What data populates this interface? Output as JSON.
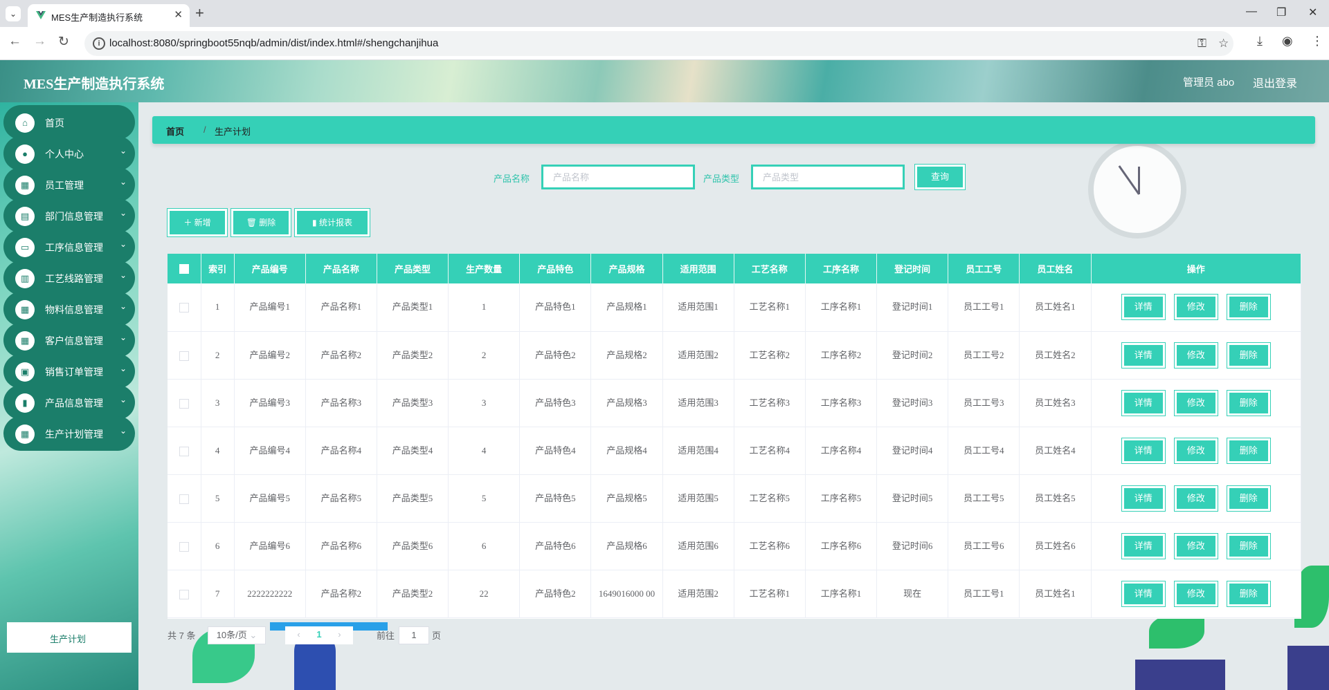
{
  "browser": {
    "tab_title": "MES生产制造执行系统",
    "url": "localhost:8080/springboot55nqb/admin/dist/index.html#/shengchanjihua"
  },
  "header": {
    "title": "MES生产制造执行系统",
    "user": "管理员 abo",
    "logout": "退出登录"
  },
  "sidebar": {
    "items": [
      {
        "label": "首页",
        "icon": "home-icon",
        "glyph": "⌂",
        "expandable": false
      },
      {
        "label": "个人中心",
        "icon": "user-icon",
        "glyph": "●",
        "expandable": true
      },
      {
        "label": "员工管理",
        "icon": "grid-icon",
        "glyph": "▦",
        "expandable": true
      },
      {
        "label": "部门信息管理",
        "icon": "chart-icon",
        "glyph": "▤",
        "expandable": true
      },
      {
        "label": "工序信息管理",
        "icon": "chat-icon",
        "glyph": "▭",
        "expandable": true
      },
      {
        "label": "工艺线路管理",
        "icon": "clipboard-icon",
        "glyph": "▥",
        "expandable": true
      },
      {
        "label": "物料信息管理",
        "icon": "grid-icon",
        "glyph": "▦",
        "expandable": true
      },
      {
        "label": "客户信息管理",
        "icon": "apps-icon",
        "glyph": "▦",
        "expandable": true
      },
      {
        "label": "销售订单管理",
        "icon": "monitor-icon",
        "glyph": "▣",
        "expandable": true
      },
      {
        "label": "产品信息管理",
        "icon": "book-icon",
        "glyph": "▮",
        "expandable": true
      },
      {
        "label": "生产计划管理",
        "icon": "grid-icon",
        "glyph": "▦",
        "expandable": true
      }
    ],
    "submenu_active": "生产计划"
  },
  "breadcrumb": {
    "home": "首页",
    "separator": "/",
    "current": "生产计划"
  },
  "search": {
    "name_label": "产品名称",
    "name_placeholder": "产品名称",
    "type_label": "产品类型",
    "type_placeholder": "产品类型",
    "button": "查询"
  },
  "actions": {
    "add": "新增",
    "delete": "删除",
    "report": "统计报表"
  },
  "table": {
    "columns": [
      "索引",
      "产品编号",
      "产品名称",
      "产品类型",
      "生产数量",
      "产品特色",
      "产品规格",
      "适用范围",
      "工艺名称",
      "工序名称",
      "登记时间",
      "员工工号",
      "员工姓名",
      "操作"
    ],
    "row_actions": {
      "detail": "详情",
      "edit": "修改",
      "delete": "删除"
    },
    "rows": [
      [
        "1",
        "产品编号1",
        "产品名称1",
        "产品类型1",
        "1",
        "产品特色1",
        "产品规格1",
        "适用范围1",
        "工艺名称1",
        "工序名称1",
        "登记时间1",
        "员工工号1",
        "员工姓名1"
      ],
      [
        "2",
        "产品编号2",
        "产品名称2",
        "产品类型2",
        "2",
        "产品特色2",
        "产品规格2",
        "适用范围2",
        "工艺名称2",
        "工序名称2",
        "登记时间2",
        "员工工号2",
        "员工姓名2"
      ],
      [
        "3",
        "产品编号3",
        "产品名称3",
        "产品类型3",
        "3",
        "产品特色3",
        "产品规格3",
        "适用范围3",
        "工艺名称3",
        "工序名称3",
        "登记时间3",
        "员工工号3",
        "员工姓名3"
      ],
      [
        "4",
        "产品编号4",
        "产品名称4",
        "产品类型4",
        "4",
        "产品特色4",
        "产品规格4",
        "适用范围4",
        "工艺名称4",
        "工序名称4",
        "登记时间4",
        "员工工号4",
        "员工姓名4"
      ],
      [
        "5",
        "产品编号5",
        "产品名称5",
        "产品类型5",
        "5",
        "产品特色5",
        "产品规格5",
        "适用范围5",
        "工艺名称5",
        "工序名称5",
        "登记时间5",
        "员工工号5",
        "员工姓名5"
      ],
      [
        "6",
        "产品编号6",
        "产品名称6",
        "产品类型6",
        "6",
        "产品特色6",
        "产品规格6",
        "适用范围6",
        "工艺名称6",
        "工序名称6",
        "登记时间6",
        "员工工号6",
        "员工姓名6"
      ],
      [
        "7",
        "2222222222",
        "产品名称2",
        "产品类型2",
        "22",
        "产品特色2",
        "1649016000 00",
        "适用范围2",
        "工艺名称1",
        "工序名称1",
        "现在",
        "员工工号1",
        "员工姓名1"
      ]
    ]
  },
  "pagination": {
    "total": "共 7 条",
    "page_size": "10条/页",
    "current_page": "1",
    "goto_label": "前往",
    "goto_value": "1",
    "page_suffix": "页"
  },
  "colors": {
    "accent": "#35d0b7",
    "sidebar_item": "#1b7e6a"
  }
}
